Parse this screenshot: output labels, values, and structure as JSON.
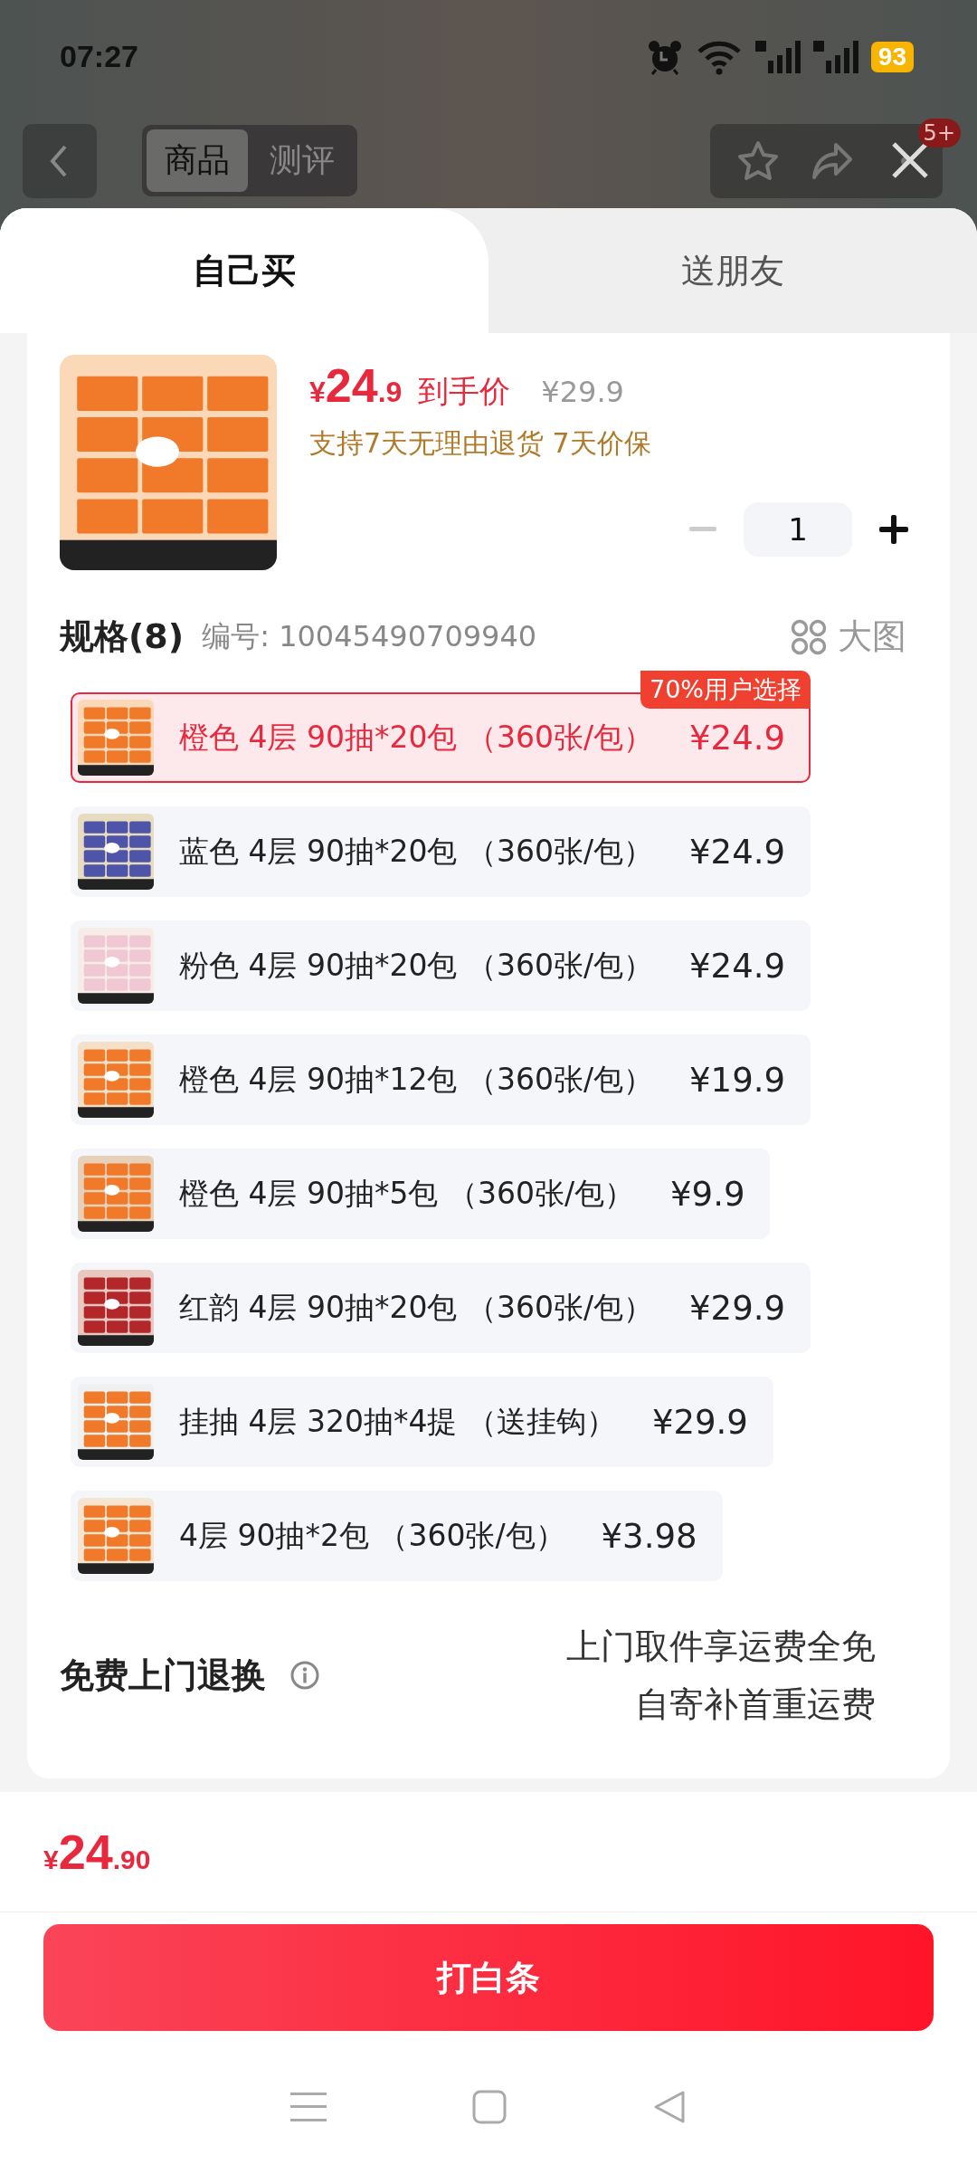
{
  "status_bar": {
    "time": "07:27",
    "battery": "93"
  },
  "nav": {
    "tabs": [
      {
        "label": "商品",
        "selected": true
      },
      {
        "label": "测评",
        "selected": false
      }
    ],
    "badge": "5+"
  },
  "sheet_tabs": [
    {
      "label": "自己买",
      "selected": true
    },
    {
      "label": "送朋友",
      "selected": false
    }
  ],
  "product": {
    "currency": "¥",
    "price_int": "24",
    "price_dec": ".9",
    "price_label": "到手价",
    "original_price": "¥29.9",
    "guarantee": "支持7天无理由退货 7天价保",
    "quantity": "1"
  },
  "specs": {
    "title": "规格(8)",
    "code": "编号: 10045490709940",
    "big_image": "大图",
    "items": [
      {
        "name": "橙色 4层 90抽*20包 （360张/包）",
        "price": "¥24.9",
        "selected": true,
        "tag": "70%用户选择"
      },
      {
        "name": "蓝色 4层 90抽*20包 （360张/包）",
        "price": "¥24.9",
        "selected": false
      },
      {
        "name": "粉色 4层 90抽*20包 （360张/包）",
        "price": "¥24.9",
        "selected": false
      },
      {
        "name": "橙色 4层 90抽*12包 （360张/包）",
        "price": "¥19.9",
        "selected": false
      },
      {
        "name": "橙色 4层 90抽*5包 （360张/包）",
        "price": "¥9.9",
        "selected": false
      },
      {
        "name": "红韵 4层 90抽*20包 （360张/包）",
        "price": "¥29.9",
        "selected": false
      },
      {
        "name": "挂抽 4层 320抽*4提 （送挂钩）",
        "price": "¥29.9",
        "selected": false
      },
      {
        "name": "4层 90抽*2包 （360张/包）",
        "price": "¥3.98",
        "selected": false
      }
    ]
  },
  "returns": {
    "title": "免费上门退换",
    "lines": [
      "上门取件享运费全免",
      "自寄补首重运费"
    ]
  },
  "bottom": {
    "currency": "¥",
    "price_int": "24",
    "price_dec": ".90",
    "button": "打白条"
  }
}
